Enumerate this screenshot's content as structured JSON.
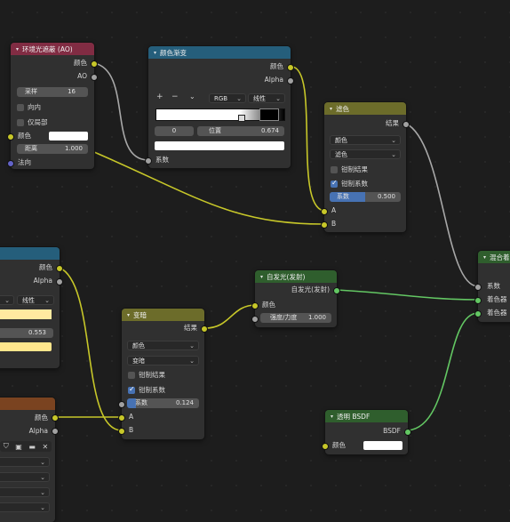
{
  "colors": {
    "accent": "#4772b3",
    "socket_color": "#c7c729",
    "socket_gray": "#a1a1a1",
    "socket_shader": "#63c763",
    "socket_vector": "#6363c7"
  },
  "ao_node": {
    "title": "环境光遮蔽 (AO)",
    "out_color": "颜色",
    "out_ao": "AO",
    "samples_label": "采样",
    "samples_value": "16",
    "inside_label": "向内",
    "only_local_label": "仅局部",
    "in_color": "颜色",
    "distance_label": "距离",
    "distance_value": "1.000",
    "normal_label": "法向"
  },
  "ramp_node": {
    "title": "颜色渐变",
    "out_color": "颜色",
    "out_alpha": "Alpha",
    "add_icon": "plus-icon",
    "remove_icon": "minus-icon",
    "mode": "RGB",
    "interp": "线性",
    "stop_index": "0",
    "pos_label": "位置",
    "pos_value": "0.674",
    "in_fac": "系数"
  },
  "filter_node": {
    "title": "滤色",
    "out_result": "结果",
    "type_value": "颜色",
    "blend_value": "滤色",
    "clamp_result": "钳制结果",
    "clamp_factor": "钳制系数",
    "fac_label": "系数",
    "fac_value": "0.500",
    "in_a": "A",
    "in_b": "B"
  },
  "left_ramp": {
    "out_color": "颜色",
    "out_alpha": "Alpha",
    "interp": "线性",
    "pos_value": "0.553"
  },
  "darken_node": {
    "title": "变暗",
    "out_result": "结果",
    "type_value": "颜色",
    "blend_value": "变暗",
    "clamp_result": "钳制结果",
    "clamp_factor": "钳制系数",
    "fac_label": "系数",
    "fac_value": "0.124",
    "in_a": "A",
    "in_b": "B"
  },
  "emission_node": {
    "title": "自发光(发射)",
    "out_label": "自发光(发射)",
    "in_color": "颜色",
    "strength_label": "强度/力度",
    "strength_value": "1.000"
  },
  "mix_shader_node": {
    "title": "混合着",
    "in_fac": "系数",
    "in_shader1": "着色器",
    "in_shader2": "着色器"
  },
  "transparent_node": {
    "title": "透明 BSDF",
    "out_bsdf": "BSDF",
    "in_color": "颜色"
  },
  "image_node": {
    "out_color": "颜色",
    "out_alpha": "Alpha",
    "icons": [
      "shield-icon",
      "image-icon",
      "folder-icon",
      "close-icon"
    ]
  }
}
